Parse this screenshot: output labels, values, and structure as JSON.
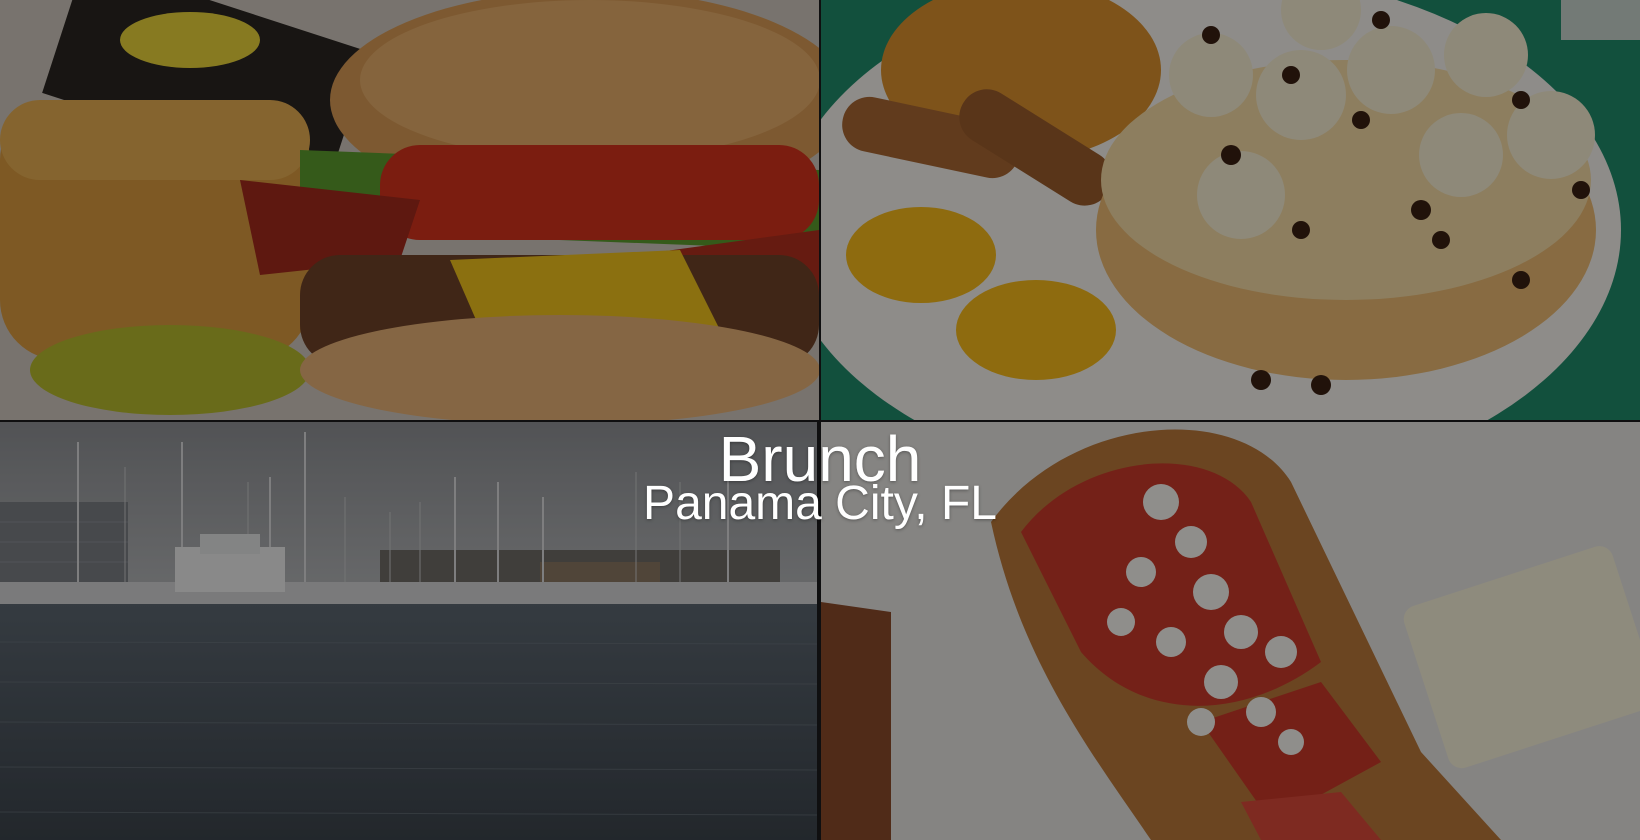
{
  "header": {
    "title": "Brunch",
    "subtitle": "Panama City, FL"
  },
  "colors": {
    "overlay": "#000000",
    "text": "#ffffff"
  },
  "images": [
    {
      "name": "burger-photo"
    },
    {
      "name": "pancake-breakfast-photo"
    },
    {
      "name": "marina-photo"
    },
    {
      "name": "french-toast-photo"
    }
  ]
}
